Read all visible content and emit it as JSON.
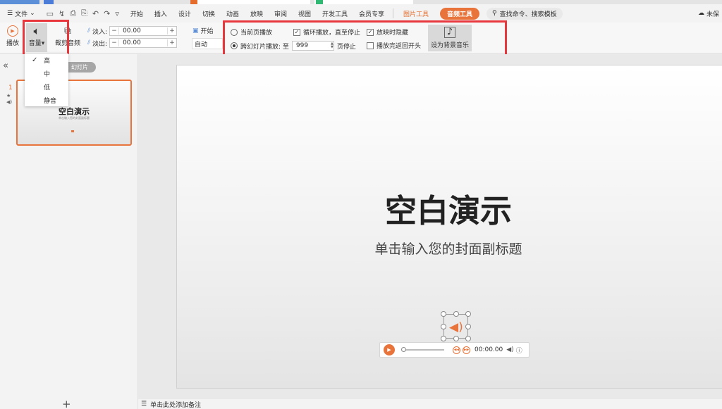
{
  "menu": {
    "file": "文件",
    "tabs": [
      "开始",
      "插入",
      "设计",
      "切换",
      "动画",
      "放映",
      "审阅",
      "视图",
      "开发工具",
      "会员专享"
    ],
    "picture_tools": "图片工具",
    "audio_tools": "音频工具",
    "search_placeholder": "查找命令、搜索模板",
    "cloud_label": "未保"
  },
  "ribbon": {
    "play_label": "播放",
    "volume_label": "音量",
    "trim_label": "裁剪音频",
    "fade_in_label": "淡入:",
    "fade_in_value": "00.00",
    "fade_out_label": "淡出:",
    "fade_out_value": "00.00",
    "start_label": "开始",
    "auto_value": "自动",
    "current_page_play": "当前页播放",
    "cross_slide_play": "跨幻灯片播放: 至",
    "cross_slide_value": "999",
    "page_stop": "页停止",
    "loop_until_stop": "循环播放，直至停止",
    "hide_when_playing": "放映时隐藏",
    "rewind_after_play": "播放完返回开头",
    "set_bg_music": "设为背景音乐"
  },
  "volume_menu": {
    "items": [
      "高",
      "中",
      "低",
      "静音"
    ],
    "selected": "高"
  },
  "left_pane": {
    "pill": "幻灯片",
    "slide_number": "1",
    "thumb_title": "空白演示",
    "thumb_subtitle": "单击输入您的封面副标题"
  },
  "slide": {
    "title": "空白演示",
    "subtitle": "单击输入您的封面副标题"
  },
  "player": {
    "time": "00:00.00"
  },
  "notes": {
    "placeholder": "单击此处添加备注"
  },
  "colors": {
    "accent": "#e8743b",
    "highlight_box": "#e8383d"
  }
}
